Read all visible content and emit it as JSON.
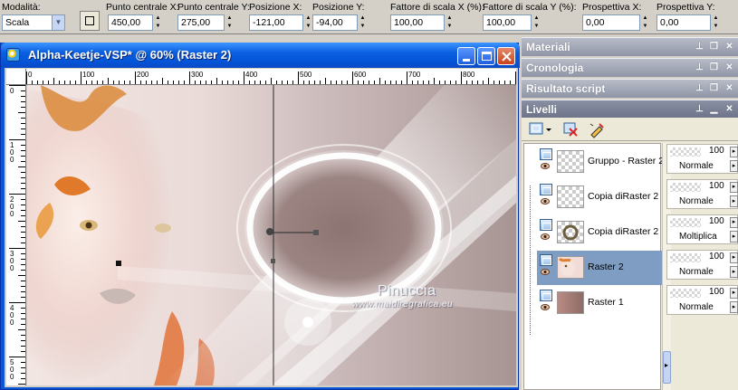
{
  "options": {
    "mode_label": "Modalità:",
    "mode_value": "Scala",
    "center_x_label": "Punto centrale X:",
    "center_x_value": "450,00",
    "center_y_label": "Punto centrale Y:",
    "center_y_value": "275,00",
    "pos_x_label": "Posizione X:",
    "pos_x_value": "-121,00",
    "pos_y_label": "Posizione Y:",
    "pos_y_value": "-94,00",
    "scale_x_label": "Fattore di scala X (%):",
    "scale_x_value": "100,00",
    "scale_y_label": "Fattore di scala Y (%):",
    "scale_y_value": "100,00",
    "persp_x_label": "Prospettiva X:",
    "persp_x_value": "0,00",
    "persp_y_label": "Prospettiva Y:",
    "persp_y_value": "0,00"
  },
  "window": {
    "title": "Alpha-Keetje-VSP* @  60% (Raster 2)",
    "watermark_line1": "Pinuccia",
    "watermark_line2": "www.maidiregrafica.eu"
  },
  "rulers": {
    "h_ticks": [
      "0",
      "100",
      "200",
      "300",
      "400",
      "500",
      "600",
      "700",
      "800"
    ],
    "v_ticks": [
      "0",
      "1 0 0",
      "2 0 0",
      "3 0 0",
      "4 0 0",
      "5 0 0"
    ]
  },
  "palettes": {
    "materiali": "Materiali",
    "cronologia": "Cronologia",
    "risultato": "Risultato script",
    "livelli": "Livelli"
  },
  "layers": [
    {
      "name": "Gruppo - Raster 2",
      "opacity": "100",
      "mode": "Normale",
      "selected": false
    },
    {
      "name": "Copia diRaster 2",
      "opacity": "100",
      "mode": "Normale",
      "selected": false
    },
    {
      "name": "Copia diRaster 2",
      "opacity": "100",
      "mode": "Moltiplica",
      "selected": false
    },
    {
      "name": "Raster 2",
      "opacity": "100",
      "mode": "Normale",
      "selected": true
    },
    {
      "name": "Raster 1",
      "opacity": "100",
      "mode": "Normale",
      "selected": false
    }
  ],
  "colors": {
    "title_blue": "#0a5fe0",
    "palette_header": "#8f95a6",
    "selected_layer": "#7f9dc3"
  }
}
